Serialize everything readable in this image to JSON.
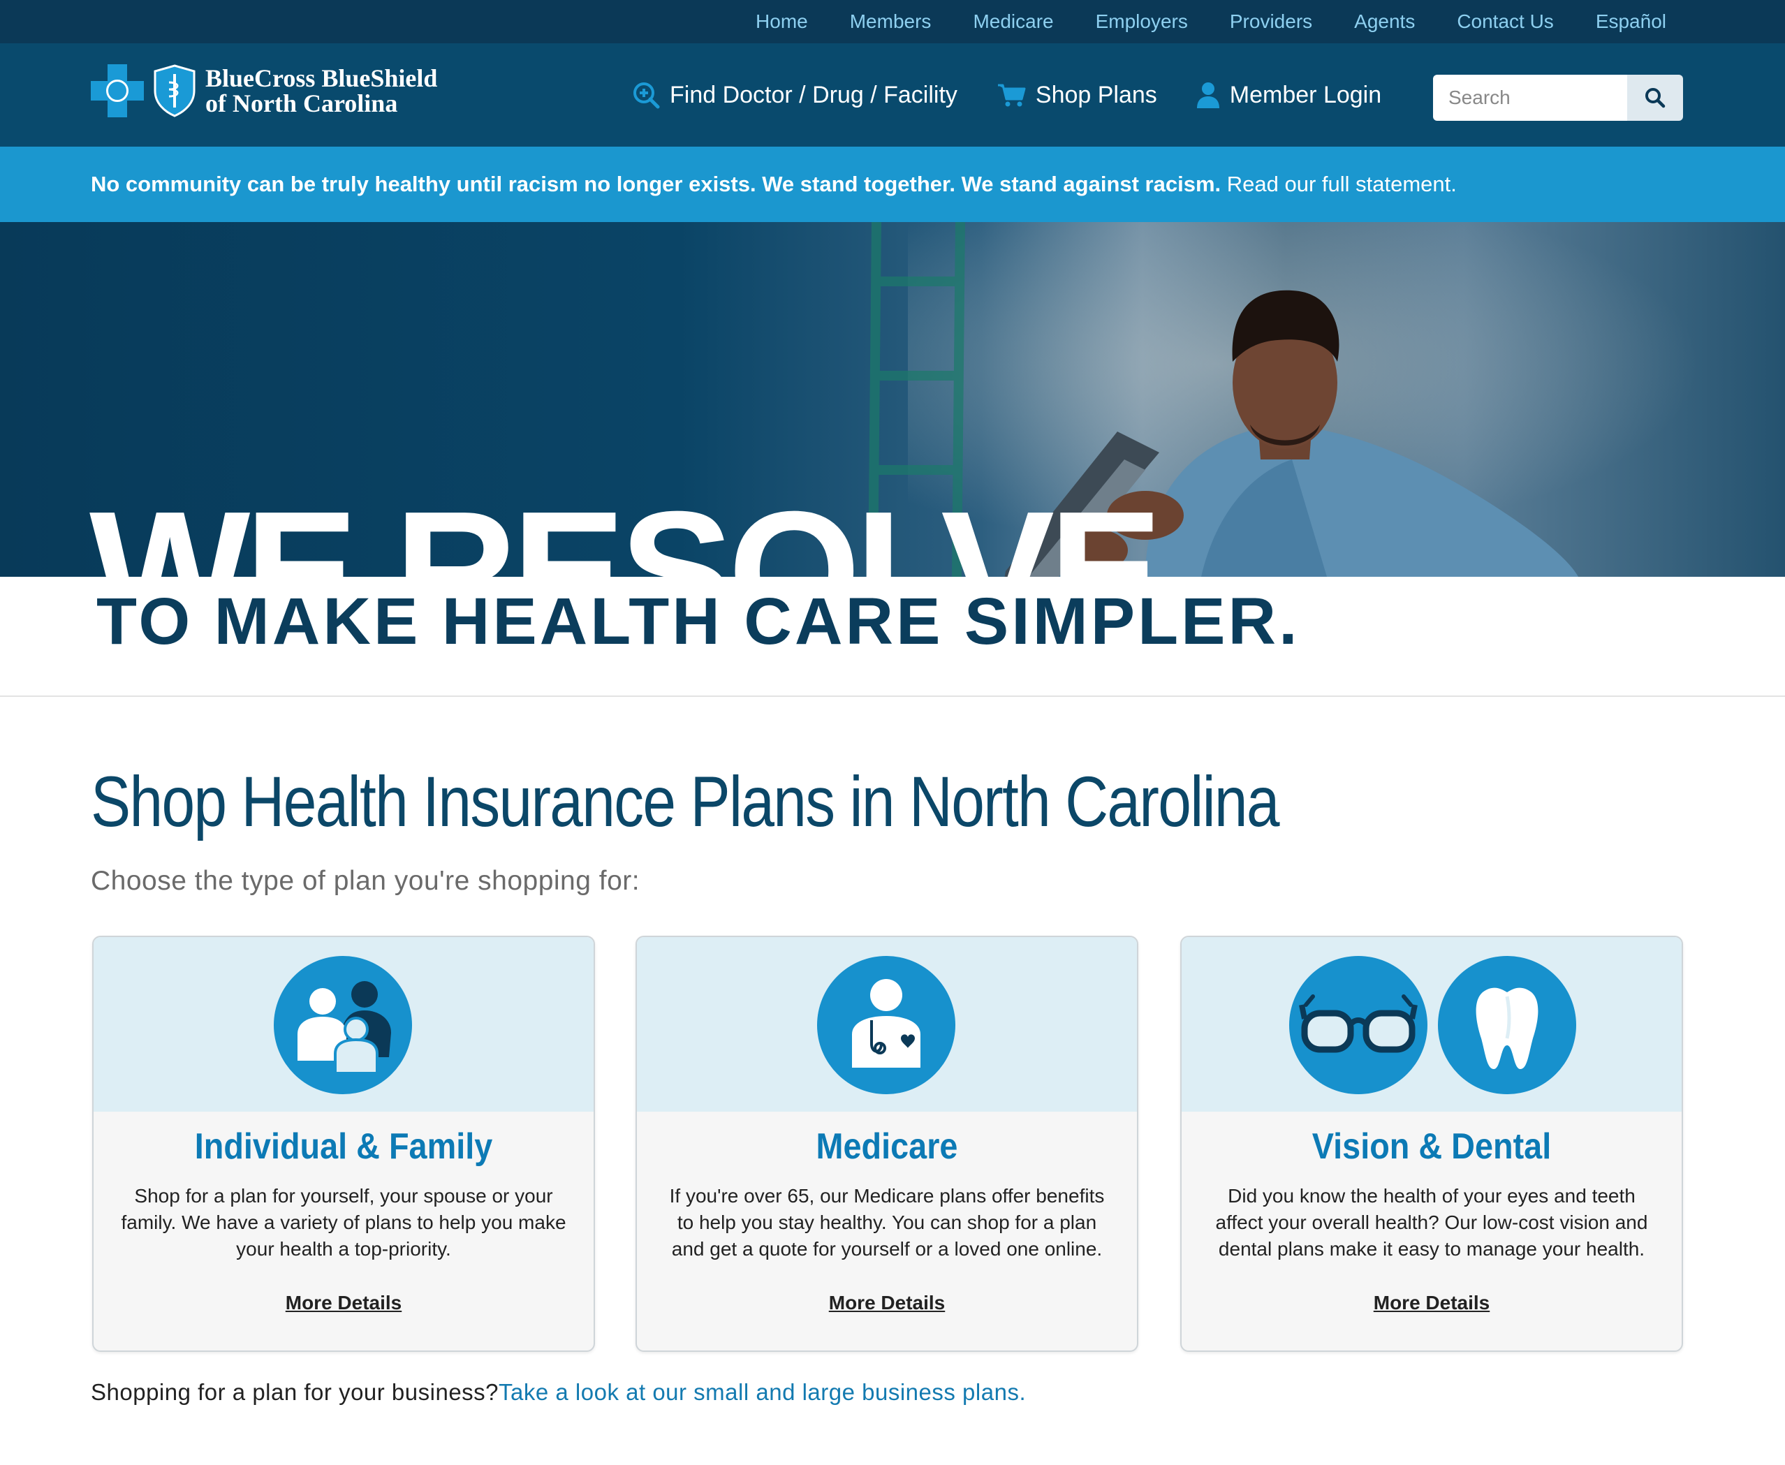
{
  "topnav": {
    "links": [
      "Home",
      "Members",
      "Medicare",
      "Employers",
      "Providers",
      "Agents",
      "Contact Us",
      "Español"
    ]
  },
  "header": {
    "brand_line1": "BlueCross BlueShield",
    "brand_line2": "of North Carolina",
    "nav": {
      "find": "Find Doctor / Drug / Facility",
      "shop": "Shop Plans",
      "login": "Member Login"
    },
    "search_placeholder": "Search"
  },
  "announcement": {
    "bold": "No community can be truly healthy until racism no longer exists. We stand together. We stand against racism.",
    "link": "Read our full statement."
  },
  "hero": {
    "headline": "WE RESOLVE.",
    "subheadline": "TO MAKE HEALTH CARE SIMPLER."
  },
  "main": {
    "title": "Shop Health Insurance Plans in North Carolina",
    "subtitle": "Choose the type of plan you're shopping for:",
    "cards": [
      {
        "title": "Individual & Family",
        "body": "Shop for a plan for yourself, your spouse or your family. We have a variety of plans to help you make your health a top-priority.",
        "link": "More Details",
        "icon": "family-icon"
      },
      {
        "title": "Medicare",
        "body": "If you're over 65, our Medicare plans offer benefits to help you stay healthy. You can shop for a plan and get a quote for yourself or a loved one online.",
        "link": "More Details",
        "icon": "doctor-icon"
      },
      {
        "title": "Vision & Dental",
        "body": "Did you know the health of your eyes and teeth affect your overall health? Our low-cost vision and dental plans make it easy to manage your health.",
        "link": "More Details",
        "icon": "glasses-icon, tooth-icon"
      }
    ],
    "business_text": "Shopping for a plan for your business?",
    "business_link": "Take a look at our small and large business plans."
  },
  "colors": {
    "top_nav_bg": "#0b3957",
    "header_bg": "#094a6d",
    "announcement_bg": "#1b97cf",
    "accent": "#1791cd",
    "heading": "#0b4768"
  }
}
